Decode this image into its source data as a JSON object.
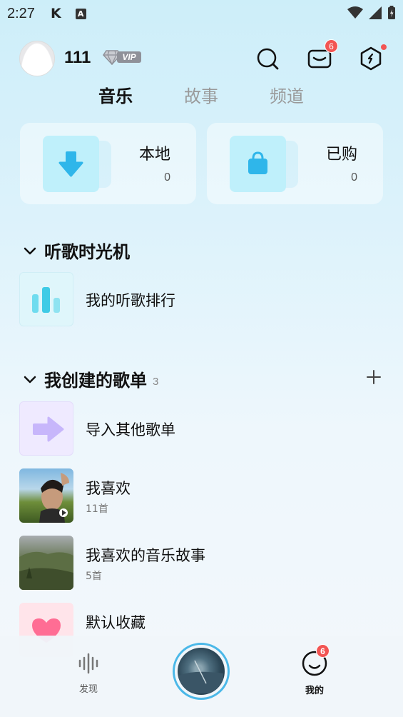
{
  "status_bar": {
    "time": "2:27",
    "k_icon": "K",
    "a_icon": "A"
  },
  "header": {
    "username": "111",
    "vip_label": "VIP",
    "mail_badge": "6"
  },
  "tabs": [
    {
      "label": "音乐",
      "active": true
    },
    {
      "label": "故事",
      "active": false
    },
    {
      "label": "频道",
      "active": false
    }
  ],
  "cards": {
    "local": {
      "label": "本地",
      "count": "0"
    },
    "purchased": {
      "label": "已购",
      "count": "0"
    }
  },
  "sections": {
    "time_machine": {
      "title": "听歌时光机",
      "items": [
        {
          "title": "我的听歌排行"
        }
      ]
    },
    "my_playlists": {
      "title": "我创建的歌单",
      "count": "3",
      "items": [
        {
          "title": "导入其他歌单",
          "sub": ""
        },
        {
          "title": "我喜欢",
          "sub": "11首"
        },
        {
          "title": "我喜欢的音乐故事",
          "sub": "5首"
        },
        {
          "title": "默认收藏",
          "sub": ""
        }
      ]
    }
  },
  "bottom_nav": {
    "discover": "发现",
    "mine": "我的",
    "mine_badge": "6"
  },
  "colors": {
    "accent": "#4bb8e8",
    "badge": "#f25553",
    "tile": "#bff0fb"
  }
}
